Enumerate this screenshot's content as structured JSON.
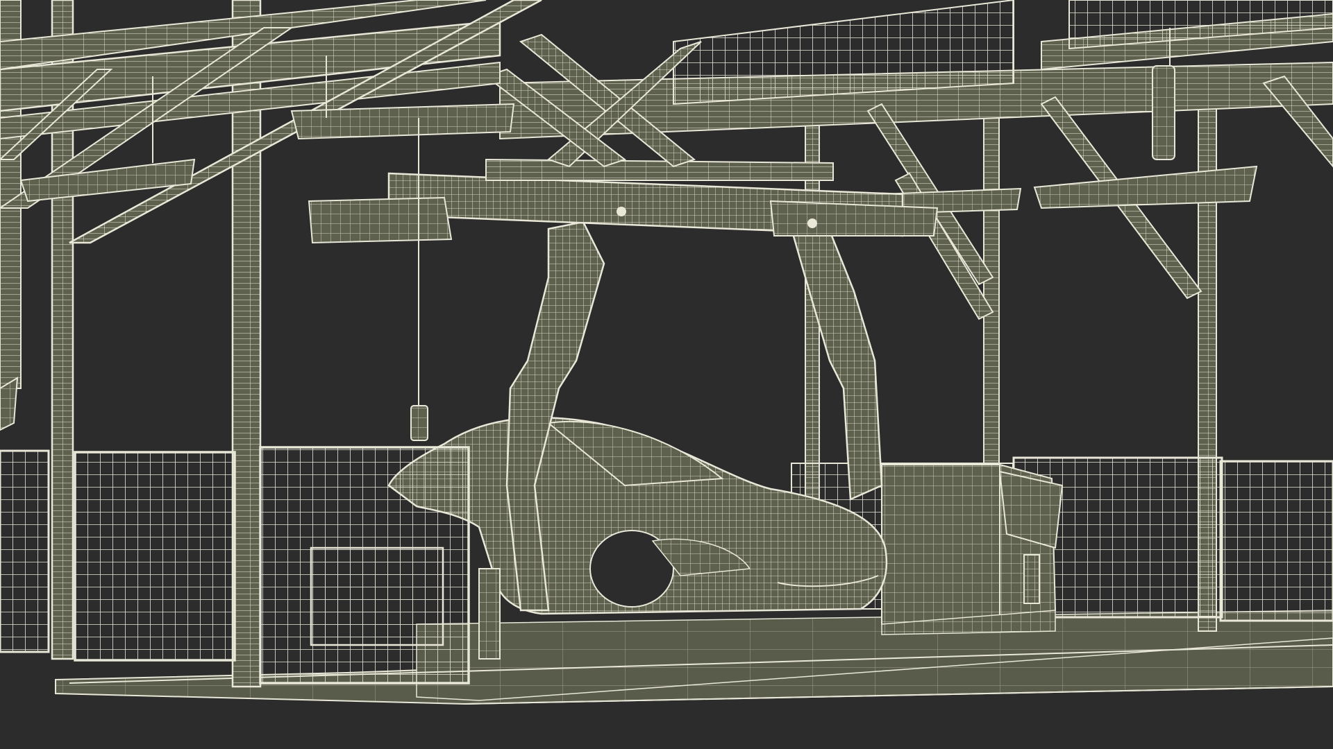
{
  "scene": {
    "background_color": "#2c2c2d",
    "model_fill_color": "#5f614f",
    "wire_color": "#e9e8d8",
    "highlight_fill_color": "#76786a",
    "objects": [
      "steel-frame",
      "overhead-gantry",
      "car-carrier-hanger",
      "car-body",
      "safety-fence",
      "control-cabinet",
      "floor-platform",
      "hanging-light",
      "pendant-control"
    ]
  }
}
